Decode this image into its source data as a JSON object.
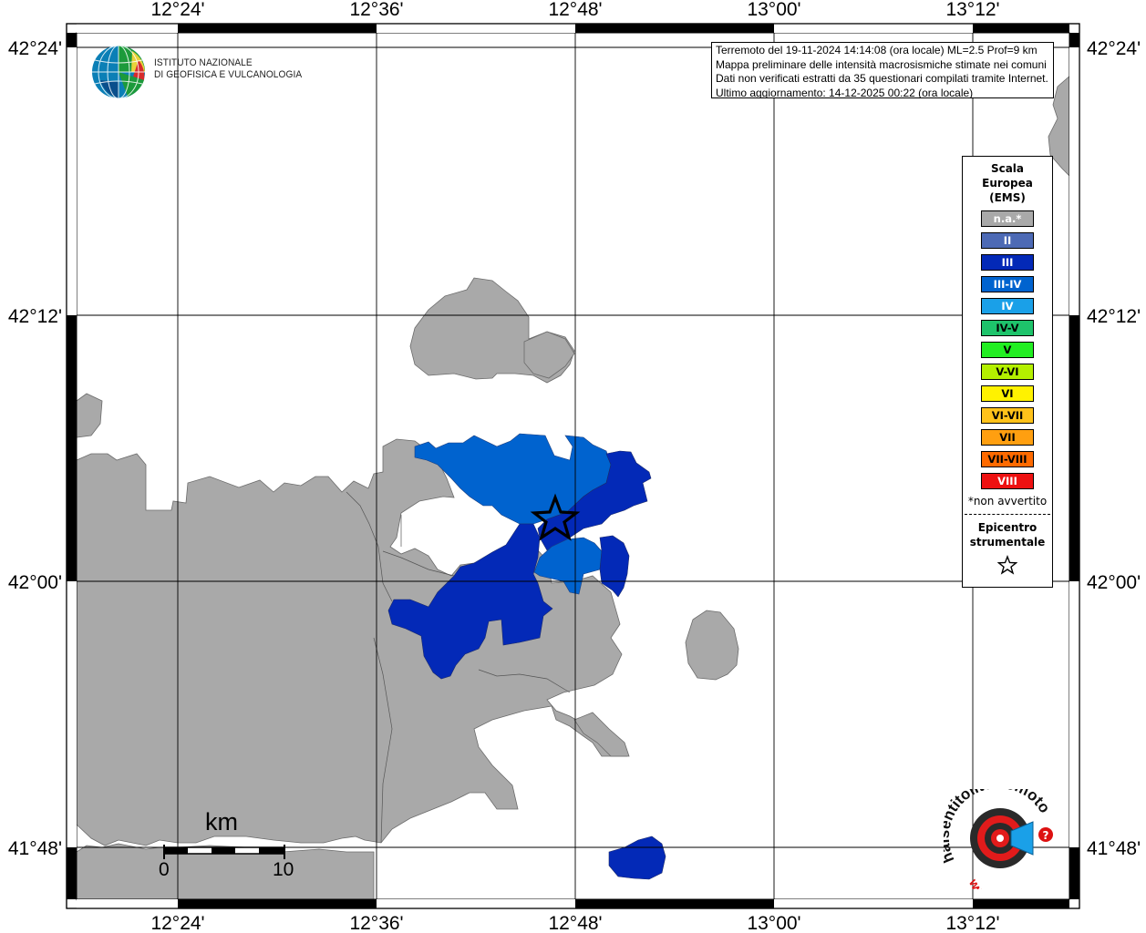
{
  "map": {
    "lon_labels_top": [
      "12°24'",
      "12°36'",
      "12°48'",
      "13°00'",
      "13°12'"
    ],
    "lon_labels_bottom": [
      "12°24'",
      "12°36'",
      "12°48'",
      "13°00'",
      "13°12'"
    ],
    "lat_labels_left": [
      "42°24'",
      "42°12'",
      "42°00'",
      "41°48'"
    ],
    "lat_labels_right": [
      "42°24'",
      "42°12'",
      "42°00'",
      "41°48'"
    ]
  },
  "info_box": {
    "line1": "Terremoto del 19-11-2024 14:14:08 (ora locale) ML=2.5 Prof=9 km",
    "line2": "Mappa preliminare delle intensità macrosismiche stimate nei comuni",
    "line3": "Dati non verificati estratti da 35 questionari compilati tramite Internet.",
    "line4": "Ultimo aggiornamento: 14-12-2025 00:22 (ora locale)"
  },
  "logo": {
    "line1": "ISTITUTO NAZIONALE",
    "line2": "DI GEOFISICA E VULCANOLOGIA"
  },
  "legend": {
    "title_line1": "Scala",
    "title_line2": "Europea",
    "title_line3": "(EMS)",
    "items": [
      {
        "label": "n.a.*",
        "color": "#a9a9a9"
      },
      {
        "label": "II",
        "color": "#4d6ab5"
      },
      {
        "label": "III",
        "color": "#0329b7"
      },
      {
        "label": "III-IV",
        "color": "#0063cf"
      },
      {
        "label": "IV",
        "color": "#1aa0e8"
      },
      {
        "label": "IV-V",
        "color": "#1ec36b"
      },
      {
        "label": "V",
        "color": "#22ee22"
      },
      {
        "label": "V-VI",
        "color": "#b4f000"
      },
      {
        "label": "VI",
        "color": "#fff200"
      },
      {
        "label": "VI-VII",
        "color": "#ffc21a"
      },
      {
        "label": "VII",
        "color": "#ff9f10"
      },
      {
        "label": "VII-VIII",
        "color": "#ff6a00"
      },
      {
        "label": "VIII",
        "color": "#ee1111"
      }
    ],
    "note": "*non avvertito",
    "epicentre_line1": "Epicentro",
    "epicentre_line2": "strumentale"
  },
  "scale_bar": {
    "unit": "km",
    "start": "0",
    "end": "10"
  },
  "brand": {
    "text_main": "haisentitoilterremoto.it",
    "text_www": "www."
  }
}
